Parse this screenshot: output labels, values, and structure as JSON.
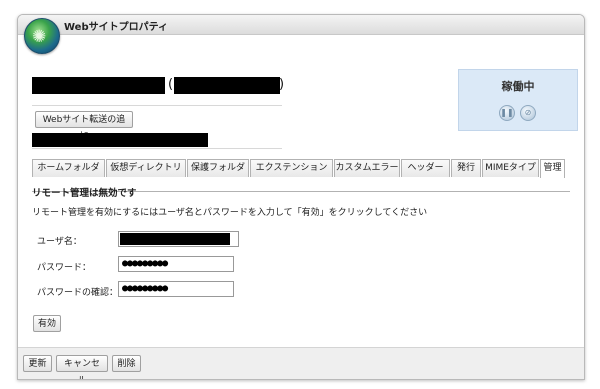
{
  "window": {
    "title": "Webサイトプロパティ"
  },
  "site": {
    "add_redirect_label": "Webサイト転送の追加"
  },
  "status": {
    "text": "稼働中",
    "pause_icon": "pause-icon",
    "stop_icon": "stop-icon"
  },
  "tabs": [
    {
      "label": "ホームフォルダ",
      "active": false
    },
    {
      "label": "仮想ディレクトリ",
      "active": false
    },
    {
      "label": "保護フォルダ",
      "active": false
    },
    {
      "label": "エクステンション",
      "active": false
    },
    {
      "label": "カスタムエラー",
      "active": false
    },
    {
      "label": "ヘッダー",
      "active": false
    },
    {
      "label": "発行",
      "active": false
    },
    {
      "label": "MIMEタイプ",
      "active": false
    },
    {
      "label": "管理",
      "active": true
    }
  ],
  "remote": {
    "heading": "リモート管理は無効です",
    "description": "リモート管理を有効にするにはユーザ名とパスワードを入力して「有効」をクリックしてください",
    "username_label": "ユーザ名：",
    "password_label": "パスワード：",
    "password_value": "●●●●●●●●●",
    "confirm_label": "パスワードの確認：",
    "confirm_value": "●●●●●●●●●",
    "enable_button": "有効"
  },
  "footer": {
    "update": "更新",
    "cancel": "キャンセル",
    "delete": "削除"
  }
}
